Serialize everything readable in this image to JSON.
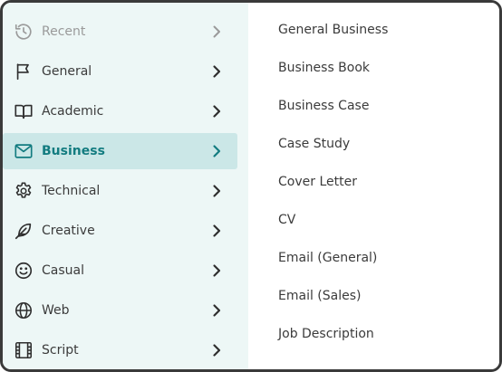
{
  "categories": [
    {
      "label": "Recent",
      "icon": "history-icon",
      "state": "muted"
    },
    {
      "label": "General",
      "icon": "flag-icon",
      "state": "normal"
    },
    {
      "label": "Academic",
      "icon": "book-icon",
      "state": "normal"
    },
    {
      "label": "Business",
      "icon": "envelope-icon",
      "state": "active"
    },
    {
      "label": "Technical",
      "icon": "gear-icon",
      "state": "normal"
    },
    {
      "label": "Creative",
      "icon": "feather-icon",
      "state": "normal"
    },
    {
      "label": "Casual",
      "icon": "smiley-icon",
      "state": "normal"
    },
    {
      "label": "Web",
      "icon": "globe-icon",
      "state": "normal"
    },
    {
      "label": "Script",
      "icon": "film-icon",
      "state": "normal"
    }
  ],
  "subitems": [
    "General Business",
    "Business Book",
    "Business Case",
    "Case Study",
    "Cover Letter",
    "CV",
    "Email (General)",
    "Email (Sales)",
    "Job Description"
  ],
  "colors": {
    "panel_left": "#edf7f6",
    "active_bg": "#cbe7e7",
    "accent": "#137c80",
    "text": "#3b3b3b",
    "muted": "#9a9a9a",
    "border": "#3a3a3a"
  }
}
